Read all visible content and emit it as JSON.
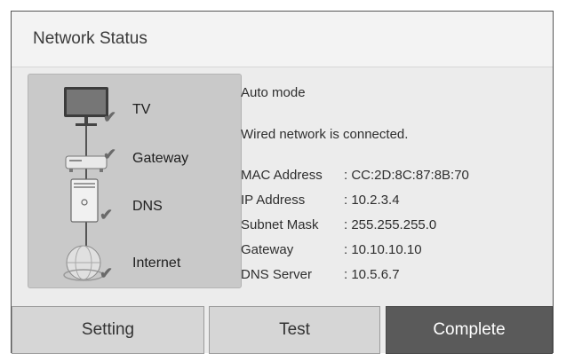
{
  "dialog": {
    "title": "Network Status"
  },
  "diagram": {
    "nodes": [
      {
        "label": "TV",
        "icon": "tv-icon"
      },
      {
        "label": "Gateway",
        "icon": "gateway-icon"
      },
      {
        "label": "DNS",
        "icon": "dns-server-icon"
      },
      {
        "label": "Internet",
        "icon": "internet-globe-icon"
      }
    ],
    "status_icon": "checkmark-icon"
  },
  "status": {
    "mode": "Auto mode",
    "message": "Wired network is connected.",
    "rows": [
      {
        "key": "MAC Address",
        "value": ": CC:2D:8C:87:8B:70"
      },
      {
        "key": "IP Address",
        "value": ": 10.2.3.4"
      },
      {
        "key": "Subnet Mask",
        "value": ": 255.255.255.0"
      },
      {
        "key": "Gateway",
        "value": ": 10.10.10.10"
      },
      {
        "key": "DNS Server",
        "value": ": 10.5.6.7"
      }
    ]
  },
  "buttons": {
    "setting": "Setting",
    "test": "Test",
    "complete": "Complete"
  },
  "colors": {
    "panel": "#ececec",
    "diagram_bg": "#c9c9c9",
    "button": "#d6d6d6",
    "button_selected": "#5a5a5a"
  }
}
